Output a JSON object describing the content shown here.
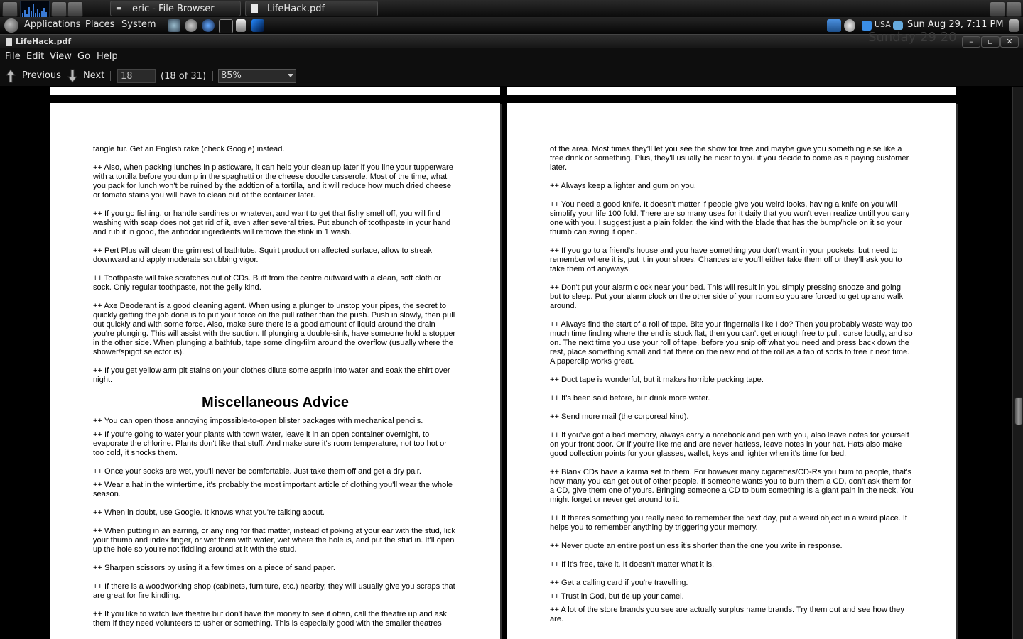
{
  "taskbar": {
    "tasks": [
      {
        "label": "eric - File Browser"
      },
      {
        "label": "LifeHack.pdf"
      }
    ]
  },
  "panel": {
    "menus": [
      "Applications",
      "Places",
      "System"
    ],
    "keyboard_layout": "USA",
    "clock": "Sun Aug 29,  7:11 PM",
    "ghost_date": "Sunday 29 20"
  },
  "window": {
    "title": "LifeHack.pdf"
  },
  "menubar": {
    "items": [
      {
        "mnemonic": "F",
        "rest": "ile"
      },
      {
        "mnemonic": "E",
        "rest": "dit"
      },
      {
        "mnemonic": "V",
        "rest": "iew"
      },
      {
        "mnemonic": "G",
        "rest": "o"
      },
      {
        "mnemonic": "H",
        "rest": "elp"
      }
    ]
  },
  "toolbar": {
    "previous_label": "Previous",
    "next_label": "Next",
    "page_value": "18",
    "page_count": "(18 of 31)",
    "zoom": "85%"
  },
  "pages": {
    "left": {
      "p1": "tangle fur. Get an English rake (check Google) instead.",
      "p2": "++ Also, when packing lunches in plasticware, it can help your clean up later if you line your tupperware with a tortilla before you dump in the spaghetti or the cheese doodle casserole. Most of the time, what you pack for lunch won't be ruined by the addtion of a tortilla, and it will reduce how much dried cheese or tomato stains you will have to clean out of the container later.",
      "p3": "++ If you go fishing, or handle sardines or whatever, and want to get that fishy smell off, you will find washing with soap does not get rid of it, even after several tries. Put abunch of toothpaste in your hand and rub it in good, the antiodor ingredients will remove the stink in 1 wash.",
      "p4": "++ Pert Plus will clean the grimiest of bathtubs. Squirt product on affected surface, allow to streak downward and apply moderate scrubbing vigor.",
      "p5": "++ Toothpaste will take scratches out of CDs. Buff from the centre outward with a clean, soft cloth or sock. Only regular toothpaste, not the gelly kind.",
      "p6": "++ Axe Deoderant is a good cleaning agent. When using a plunger to unstop your pipes, the secret to quickly getting the job done is to put your force on the pull rather than the push. Push in slowly, then pull out quickly and with some force. Also, make sure there is a good amount of liquid around the drain you're plunging. This will assist with the suction. If plunging a double-sink, have someone hold a stopper in the other side. When plunging a bathtub, tape some cling-film around the overflow (usually where the shower/spigot selector is).",
      "p7": "++ If you get yellow arm pit stains on your clothes dilute some asprin into water and soak the shirt over night.",
      "heading": "Miscellaneous Advice",
      "p8": "++ You can open those annoying impossible-to-open blister packages with mechanical pencils.",
      "p9": "++ If you're going to water your plants with town water, leave it in an open container overnight, to evaporate the chlorine. Plants don't like that stuff. And make sure it's room temperature, not too hot or too cold, it shocks them.",
      "p10": "++ Once your socks are wet, you'll never be comfortable. Just take them off and get a dry pair.",
      "p11": "++ Wear a hat in the wintertime, it's probably the most important article of clothing you'll wear the whole season.",
      "p12": "++ When in doubt, use Google. It knows what you're talking about.",
      "p13": "++ When putting in an earring, or any ring for that matter, instead of poking at your ear with the stud, lick your thumb and index finger, or wet them with water, wet where the hole is, and put the stud in. It'll open up the hole so you're not fiddling around at it with the stud.",
      "p14": "++ Sharpen scissors by using it a few times on a piece of sand paper.",
      "p15": "++ If there is a woodworking shop (cabinets, furniture, etc.) nearby, they will usually give you scraps that are great for fire kindling.",
      "p16": "++ If you like to watch live theatre but don't have the money to see it often, call the theatre up and ask them if they need volunteers to usher or something. This is especially good with the smaller theatres"
    },
    "right": {
      "p1": "of the area. Most times they'll let you see the show for free and maybe give you something else like a free drink or something. Plus, they'll usually be nicer to you if you decide to come as a paying customer later.",
      "p2": "++ Always keep a lighter and gum on you.",
      "p3": "++ You need a good knife. It doesn't matter if people give you weird looks, having a knife on you will simplify your life 100 fold. There are so many uses for it daily that you won't even realize untill you carry one with you. I suggest just a plain folder, the kind with the blade that has the bump/hole on it so your thumb can swing it open.",
      "p4": "++ If you go to a friend's house and you have something you don't want in your pockets, but need to remember where it is, put it in your shoes. Chances are you'll either take them off or they'll ask you to take them off anyways.",
      "p5": "++ Don't put your alarm clock near your bed. This will result in you simply pressing snooze and going but to sleep. Put your alarm clock on the other side of your room so you are forced to get up and walk around.",
      "p6": "++ Always find the start of a roll of tape. Bite your fingernails like I do? Then you probably waste way too much time finding where the end is stuck flat, then you can't get enough free to pull, curse loudly, and so on. The next time you use your roll of tape, before you snip off what you need and press back down the rest, place something small and flat there on the new end of the roll as a tab of sorts to free it next time. A paperclip works great.",
      "p7": "++ Duct tape is wonderful, but it makes horrible packing tape.",
      "p8": "++ It's been said before, but drink more water.",
      "p9": "++ Send more mail (the corporeal kind).",
      "p10": "++ If you've got a bad memory, always carry a notebook and pen with you, also leave notes for yourself on your front door. Or if you're like me and are never hatless, leave notes in your hat. Hats also make good collection points for your glasses, wallet, keys and lighter when it's time for bed.",
      "p11": "++ Blank CDs have a karma set to them. For however many cigarettes/CD-Rs you bum to people, that's how many you can get out of other people. If someone wants you to burn them a CD, don't ask them for a CD, give them one of yours. Bringing someone a CD to bum something is a giant pain in the neck. You might forget or never get around to it.",
      "p12": "++ If theres something you really need to remember the next day, put a weird object in a weird place. It helps you to remember anything by triggering your memory.",
      "p13": "++ Never quote an entire post unless it's shorter than the one you write in response.",
      "p14": "++ If it's free, take it. It doesn't matter what it is.",
      "p15": "++ Get a calling card if you're travelling.",
      "p16": "++ Trust in God, but tie up your camel.",
      "p17": "++ A lot of the store brands you see are actually surplus name brands. Try them out and see how they are."
    }
  }
}
